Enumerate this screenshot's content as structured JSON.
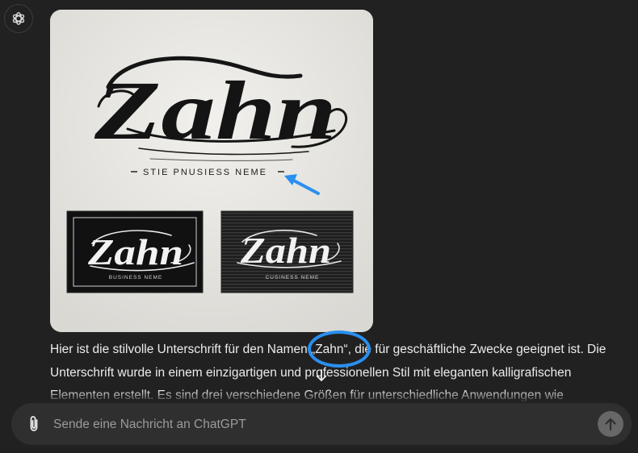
{
  "assistant": {
    "avatar_icon": "openai-logo-icon"
  },
  "image": {
    "logo_text": "Zahn",
    "tagline": "STIE PNUSIESS NEME",
    "card_left_tagline": "BUSINESS NEME",
    "card_right_tagline": "CUSINESS NEME",
    "annotation_color": "#2a8ff0"
  },
  "message": {
    "lines": [
      "Hier ist die stilvolle Unterschrift für den Namen „Zahn“, die für geschäftliche Zwecke geeignet ist. Die",
      "Unterschrift wurde in einem einzigartigen und professionellen Stil mit eleganten kalligrafischen",
      "Elementen erstellt. Es sind drei verschiedene Größen für unterschiedliche Anwendungen wie"
    ]
  },
  "composer": {
    "placeholder": "Sende eine Nachricht an ChatGPT",
    "attach_icon": "paperclip-icon",
    "send_icon": "arrow-up-icon"
  },
  "scroll": {
    "icon": "arrow-down-icon"
  }
}
